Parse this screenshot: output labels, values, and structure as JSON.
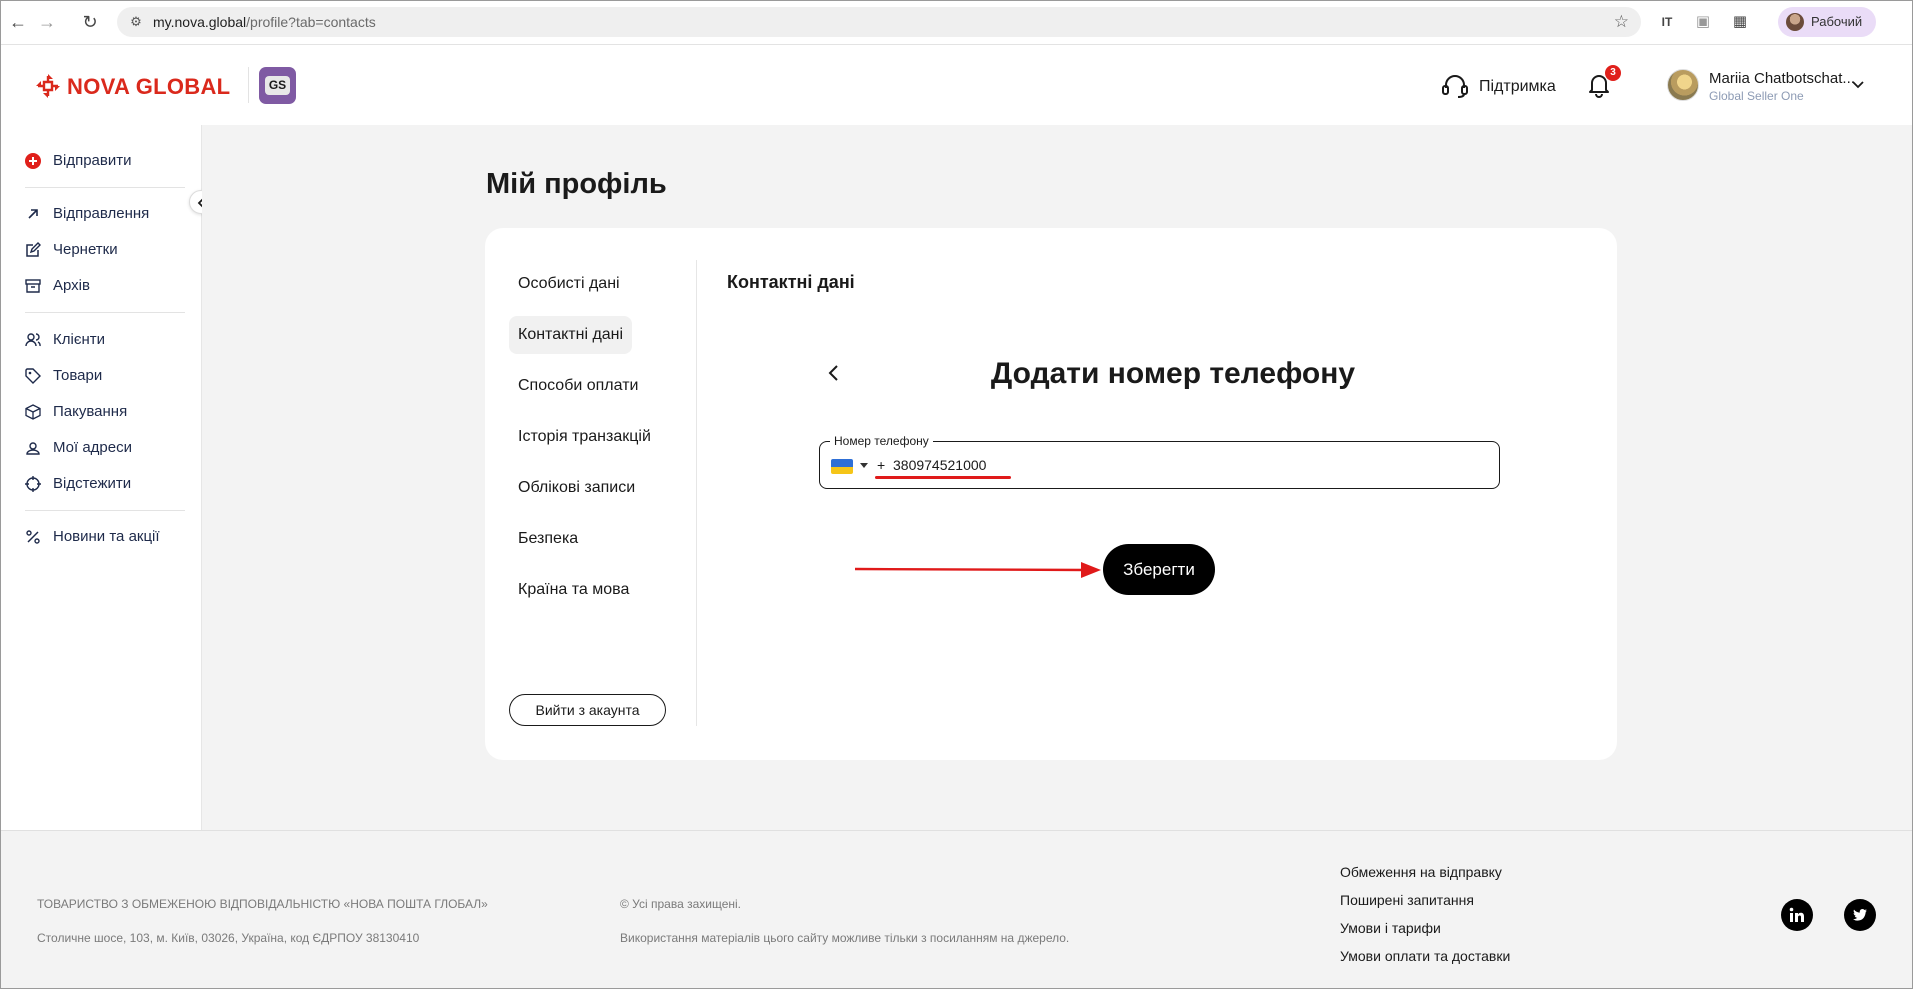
{
  "browser": {
    "url_host": "my.nova.global",
    "url_path": "/profile?tab=contacts",
    "profile_label": "Рабочий"
  },
  "header": {
    "logo_text": "NOVA GLOBAL",
    "gs_badge": "GS",
    "support_label": "Підтримка",
    "notifications_count": "3",
    "user_name": "Mariia Chatbotschat...",
    "user_org": "Global Seller One"
  },
  "sidebar": {
    "send_label": "Відправити",
    "items": [
      {
        "label": "Відправлення",
        "icon": "arrow-up-right-icon"
      },
      {
        "label": "Чернетки",
        "icon": "edit-icon"
      },
      {
        "label": "Архів",
        "icon": "archive-icon"
      },
      {
        "label": "Клієнти",
        "icon": "users-icon"
      },
      {
        "label": "Товари",
        "icon": "tag-icon"
      },
      {
        "label": "Пакування",
        "icon": "box-icon"
      },
      {
        "label": "Мої адреси",
        "icon": "location-icon"
      },
      {
        "label": "Відстежити",
        "icon": "track-icon"
      },
      {
        "label": "Новини та акції",
        "icon": "percent-icon"
      }
    ]
  },
  "main": {
    "page_title": "Мій профіль",
    "tabs": [
      {
        "label": "Особисті дані"
      },
      {
        "label": "Контактні дані"
      },
      {
        "label": "Способи оплати"
      },
      {
        "label": "Історія транзакцій"
      },
      {
        "label": "Облікові записи"
      },
      {
        "label": "Безпека"
      },
      {
        "label": "Країна та мова"
      }
    ],
    "active_tab": "Контактні дані",
    "logout_label": "Вийти з акаунта",
    "section_title": "Контактні дані",
    "form_title": "Додати номер телефону",
    "phone_label": "Номер телефону",
    "phone_prefix": "+",
    "phone_value": "380974521000",
    "save_label": "Зберегти"
  },
  "footer": {
    "company": "ТОВАРИСТВО З ОБМЕЖЕНОЮ ВІДПОВІДАЛЬНІСТЮ «НОВА ПОШТА ГЛОБАЛ»",
    "address": "Столичне шосе, 103, м. Київ, 03026, Україна, код ЄДРПОУ 38130410",
    "rights": "© Усі права захищені.",
    "usage_note": "Використання матеріалів цього сайту можливе тільки з посиланням на джерело.",
    "links": [
      "Обмеження на відправку",
      "Поширені запитання",
      "Умови і тарифи",
      "Умови оплати та доставки"
    ]
  },
  "colors": {
    "brand_red": "#da291c",
    "gs_purple": "#7f5aa3",
    "annotation_red": "#e01a1a"
  }
}
